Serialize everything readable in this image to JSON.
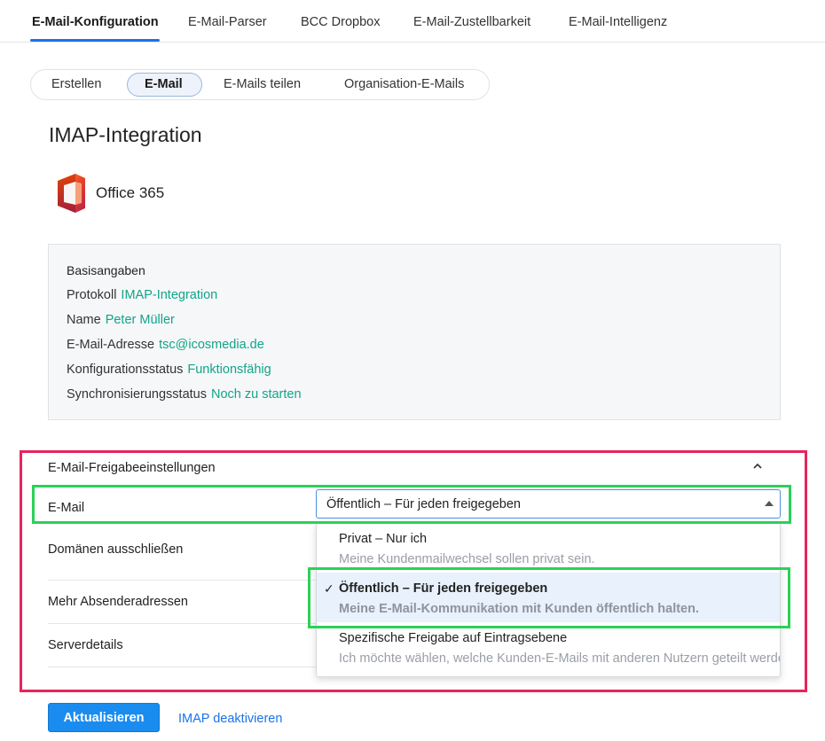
{
  "top_tabs": [
    {
      "label": "E-Mail-Konfiguration",
      "active": true
    },
    {
      "label": "E-Mail-Parser"
    },
    {
      "label": "BCC Dropbox"
    },
    {
      "label": "E-Mail-Zustellbarkeit"
    },
    {
      "label": "E-Mail-Intelligenz"
    }
  ],
  "sub_tabs": [
    {
      "label": "Erstellen"
    },
    {
      "label": "E-Mail",
      "active": true
    },
    {
      "label": "E-Mails teilen"
    },
    {
      "label": "Organisation-E-Mails"
    }
  ],
  "page_title": "IMAP-Integration",
  "provider": {
    "name": "Office 365",
    "icon": "office-365-logo"
  },
  "basic_info": {
    "heading": "Basisangaben",
    "rows": [
      {
        "label": "Protokoll",
        "value": "IMAP-Integration"
      },
      {
        "label": "Name",
        "value": "Peter Müller"
      },
      {
        "label": "E-Mail-Adresse",
        "value": "tsc@icosmedia.de"
      },
      {
        "label": "Konfigurationsstatus",
        "value": "Funktionsfähig"
      },
      {
        "label": "Synchronisierungsstatus",
        "value": "Noch zu starten"
      }
    ]
  },
  "sharing": {
    "title": "E-Mail-Freigabeeinstellungen",
    "rows": [
      {
        "label": "E-Mail"
      },
      {
        "label": "Domänen ausschließen"
      },
      {
        "label": "Mehr Absenderadressen"
      },
      {
        "label": "Serverdetails"
      }
    ],
    "select_value": "Öffentlich – Für jeden freigegeben",
    "options": [
      {
        "title": "Privat – Nur ich",
        "desc": "Meine Kundenmailwechsel sollen privat sein."
      },
      {
        "title": "Öffentlich – Für jeden freigegeben",
        "desc": "Meine E-Mail-Kommunikation mit Kunden öffentlich halten.",
        "selected": true
      },
      {
        "title": "Spezifische Freigabe auf Eintragsebene",
        "desc": "Ich möchte wählen, welche Kunden-E-Mails mit anderen Nutzern geteilt werden."
      }
    ],
    "check_mark": "✓"
  },
  "footer": {
    "update_label": "Aktualisieren",
    "deactivate_label": "IMAP deaktivieren"
  },
  "colors": {
    "accent": "#1a73e8",
    "value_text": "#12a489",
    "highlight_red": "#e6245d",
    "highlight_green": "#2bd158",
    "primary_button": "#1a8cf0"
  }
}
